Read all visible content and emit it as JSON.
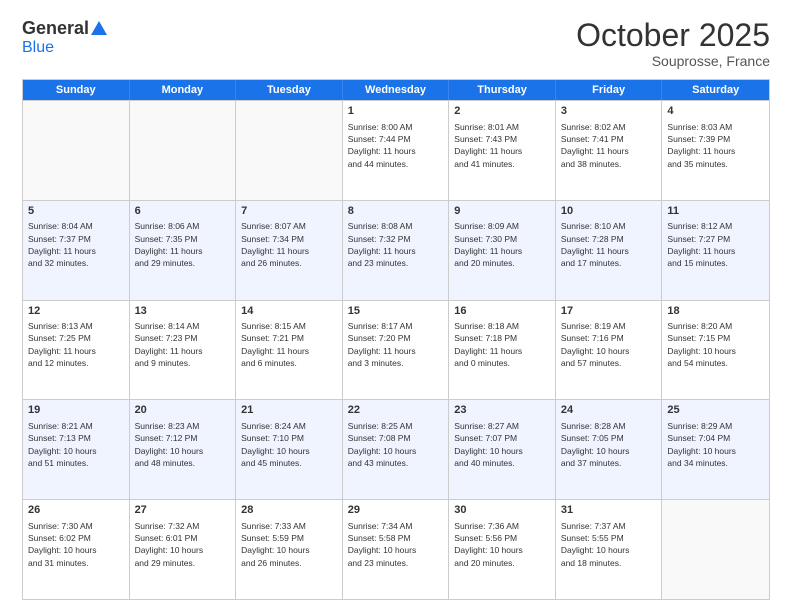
{
  "header": {
    "logo": {
      "general": "General",
      "blue": "Blue"
    },
    "title": "October 2025",
    "location": "Souprosse, France"
  },
  "days": [
    "Sunday",
    "Monday",
    "Tuesday",
    "Wednesday",
    "Thursday",
    "Friday",
    "Saturday"
  ],
  "rows": [
    [
      {
        "day": "",
        "lines": []
      },
      {
        "day": "",
        "lines": []
      },
      {
        "day": "",
        "lines": []
      },
      {
        "day": "1",
        "lines": [
          "Sunrise: 8:00 AM",
          "Sunset: 7:44 PM",
          "Daylight: 11 hours",
          "and 44 minutes."
        ]
      },
      {
        "day": "2",
        "lines": [
          "Sunrise: 8:01 AM",
          "Sunset: 7:43 PM",
          "Daylight: 11 hours",
          "and 41 minutes."
        ]
      },
      {
        "day": "3",
        "lines": [
          "Sunrise: 8:02 AM",
          "Sunset: 7:41 PM",
          "Daylight: 11 hours",
          "and 38 minutes."
        ]
      },
      {
        "day": "4",
        "lines": [
          "Sunrise: 8:03 AM",
          "Sunset: 7:39 PM",
          "Daylight: 11 hours",
          "and 35 minutes."
        ]
      }
    ],
    [
      {
        "day": "5",
        "lines": [
          "Sunrise: 8:04 AM",
          "Sunset: 7:37 PM",
          "Daylight: 11 hours",
          "and 32 minutes."
        ]
      },
      {
        "day": "6",
        "lines": [
          "Sunrise: 8:06 AM",
          "Sunset: 7:35 PM",
          "Daylight: 11 hours",
          "and 29 minutes."
        ]
      },
      {
        "day": "7",
        "lines": [
          "Sunrise: 8:07 AM",
          "Sunset: 7:34 PM",
          "Daylight: 11 hours",
          "and 26 minutes."
        ]
      },
      {
        "day": "8",
        "lines": [
          "Sunrise: 8:08 AM",
          "Sunset: 7:32 PM",
          "Daylight: 11 hours",
          "and 23 minutes."
        ]
      },
      {
        "day": "9",
        "lines": [
          "Sunrise: 8:09 AM",
          "Sunset: 7:30 PM",
          "Daylight: 11 hours",
          "and 20 minutes."
        ]
      },
      {
        "day": "10",
        "lines": [
          "Sunrise: 8:10 AM",
          "Sunset: 7:28 PM",
          "Daylight: 11 hours",
          "and 17 minutes."
        ]
      },
      {
        "day": "11",
        "lines": [
          "Sunrise: 8:12 AM",
          "Sunset: 7:27 PM",
          "Daylight: 11 hours",
          "and 15 minutes."
        ]
      }
    ],
    [
      {
        "day": "12",
        "lines": [
          "Sunrise: 8:13 AM",
          "Sunset: 7:25 PM",
          "Daylight: 11 hours",
          "and 12 minutes."
        ]
      },
      {
        "day": "13",
        "lines": [
          "Sunrise: 8:14 AM",
          "Sunset: 7:23 PM",
          "Daylight: 11 hours",
          "and 9 minutes."
        ]
      },
      {
        "day": "14",
        "lines": [
          "Sunrise: 8:15 AM",
          "Sunset: 7:21 PM",
          "Daylight: 11 hours",
          "and 6 minutes."
        ]
      },
      {
        "day": "15",
        "lines": [
          "Sunrise: 8:17 AM",
          "Sunset: 7:20 PM",
          "Daylight: 11 hours",
          "and 3 minutes."
        ]
      },
      {
        "day": "16",
        "lines": [
          "Sunrise: 8:18 AM",
          "Sunset: 7:18 PM",
          "Daylight: 11 hours",
          "and 0 minutes."
        ]
      },
      {
        "day": "17",
        "lines": [
          "Sunrise: 8:19 AM",
          "Sunset: 7:16 PM",
          "Daylight: 10 hours",
          "and 57 minutes."
        ]
      },
      {
        "day": "18",
        "lines": [
          "Sunrise: 8:20 AM",
          "Sunset: 7:15 PM",
          "Daylight: 10 hours",
          "and 54 minutes."
        ]
      }
    ],
    [
      {
        "day": "19",
        "lines": [
          "Sunrise: 8:21 AM",
          "Sunset: 7:13 PM",
          "Daylight: 10 hours",
          "and 51 minutes."
        ]
      },
      {
        "day": "20",
        "lines": [
          "Sunrise: 8:23 AM",
          "Sunset: 7:12 PM",
          "Daylight: 10 hours",
          "and 48 minutes."
        ]
      },
      {
        "day": "21",
        "lines": [
          "Sunrise: 8:24 AM",
          "Sunset: 7:10 PM",
          "Daylight: 10 hours",
          "and 45 minutes."
        ]
      },
      {
        "day": "22",
        "lines": [
          "Sunrise: 8:25 AM",
          "Sunset: 7:08 PM",
          "Daylight: 10 hours",
          "and 43 minutes."
        ]
      },
      {
        "day": "23",
        "lines": [
          "Sunrise: 8:27 AM",
          "Sunset: 7:07 PM",
          "Daylight: 10 hours",
          "and 40 minutes."
        ]
      },
      {
        "day": "24",
        "lines": [
          "Sunrise: 8:28 AM",
          "Sunset: 7:05 PM",
          "Daylight: 10 hours",
          "and 37 minutes."
        ]
      },
      {
        "day": "25",
        "lines": [
          "Sunrise: 8:29 AM",
          "Sunset: 7:04 PM",
          "Daylight: 10 hours",
          "and 34 minutes."
        ]
      }
    ],
    [
      {
        "day": "26",
        "lines": [
          "Sunrise: 7:30 AM",
          "Sunset: 6:02 PM",
          "Daylight: 10 hours",
          "and 31 minutes."
        ]
      },
      {
        "day": "27",
        "lines": [
          "Sunrise: 7:32 AM",
          "Sunset: 6:01 PM",
          "Daylight: 10 hours",
          "and 29 minutes."
        ]
      },
      {
        "day": "28",
        "lines": [
          "Sunrise: 7:33 AM",
          "Sunset: 5:59 PM",
          "Daylight: 10 hours",
          "and 26 minutes."
        ]
      },
      {
        "day": "29",
        "lines": [
          "Sunrise: 7:34 AM",
          "Sunset: 5:58 PM",
          "Daylight: 10 hours",
          "and 23 minutes."
        ]
      },
      {
        "day": "30",
        "lines": [
          "Sunrise: 7:36 AM",
          "Sunset: 5:56 PM",
          "Daylight: 10 hours",
          "and 20 minutes."
        ]
      },
      {
        "day": "31",
        "lines": [
          "Sunrise: 7:37 AM",
          "Sunset: 5:55 PM",
          "Daylight: 10 hours",
          "and 18 minutes."
        ]
      },
      {
        "day": "",
        "lines": []
      }
    ]
  ]
}
